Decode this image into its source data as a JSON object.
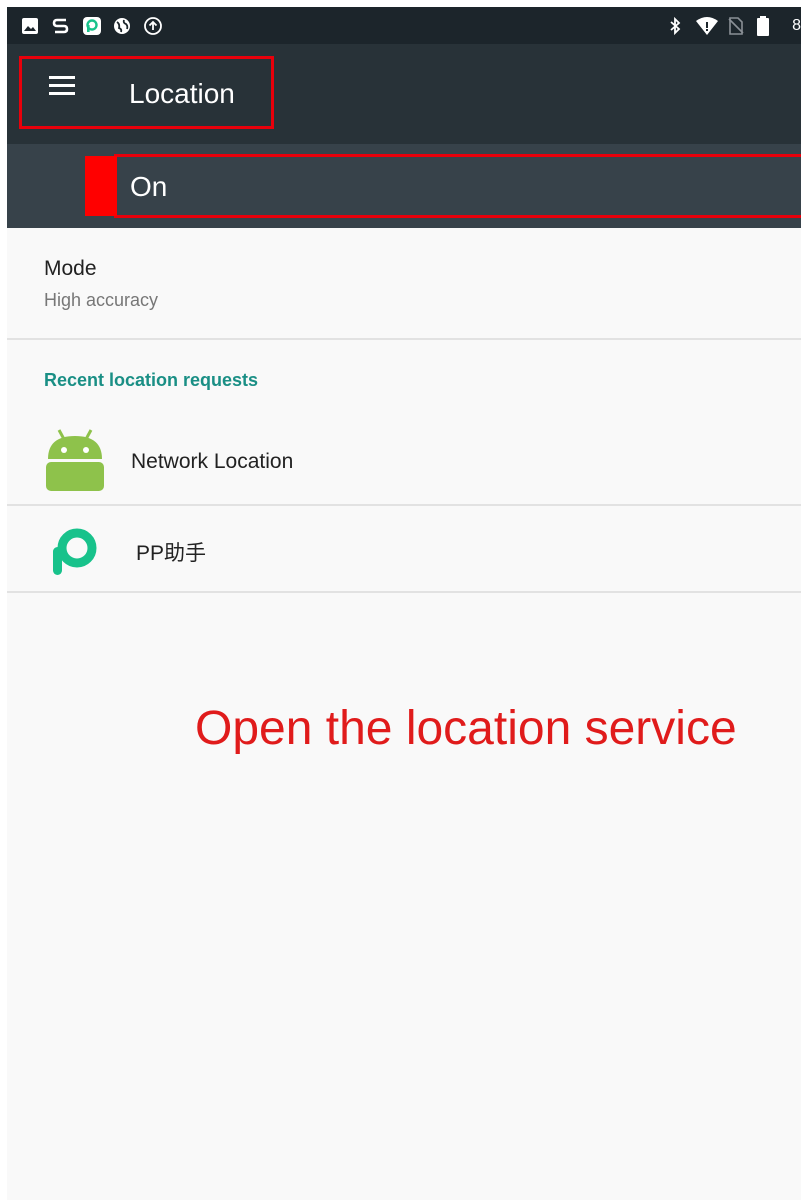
{
  "status_bar": {
    "icons_left": [
      "image-icon",
      "s-app-icon",
      "pp-app-icon",
      "globe-icon",
      "upload-icon"
    ],
    "icons_right": [
      "bluetooth-icon",
      "wifi-icon",
      "no-sim-icon",
      "battery-icon"
    ],
    "battery_text": "8"
  },
  "app_bar": {
    "menu_icon": "hamburger-menu-icon",
    "title": "Location"
  },
  "master_switch": {
    "label": "On"
  },
  "mode": {
    "title": "Mode",
    "value": "High accuracy"
  },
  "recent_requests": {
    "header": "Recent location requests",
    "items": [
      {
        "label": "Network Location",
        "icon": "android-robot-icon"
      },
      {
        "label": "PP助手",
        "icon": "pp-assistant-icon"
      }
    ]
  },
  "annotation": {
    "text": "Open the location service",
    "color": "#e01b1b"
  },
  "colors": {
    "status_bar": "#1c252b",
    "app_bar": "#283238",
    "switch_bar": "#37424a",
    "highlight": "#e8000b",
    "accent": "#1a8f85",
    "android_green": "#8ec24b",
    "pp_green": "#18c28b"
  }
}
